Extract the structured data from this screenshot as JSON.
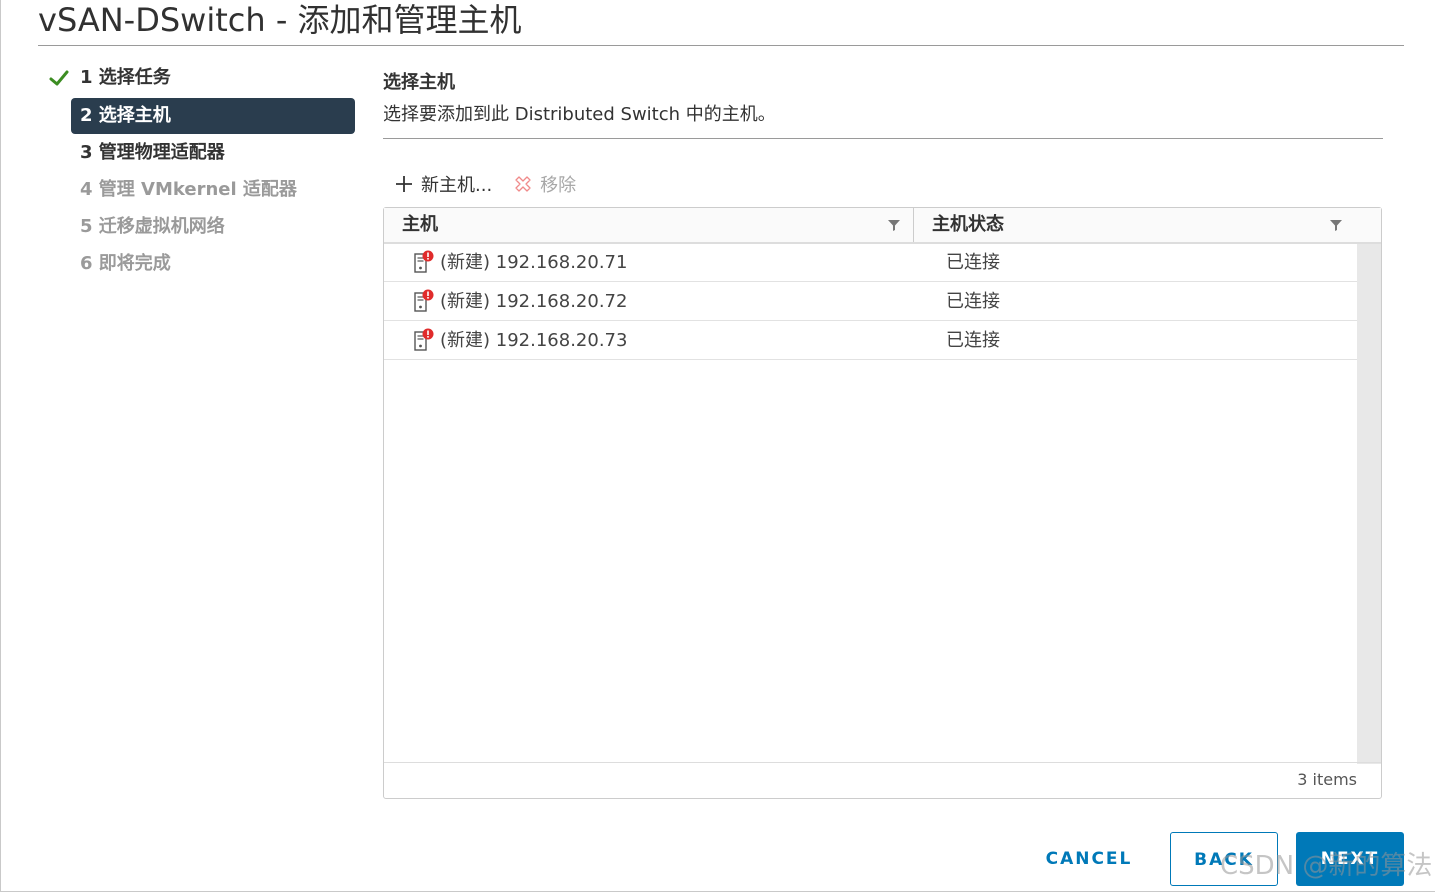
{
  "dialog": {
    "title": "vSAN-DSwitch - 添加和管理主机"
  },
  "steps": [
    {
      "label": "1 选择任务",
      "state": "done"
    },
    {
      "label": "2 选择主机",
      "state": "active"
    },
    {
      "label": "3 管理物理适配器",
      "state": "next"
    },
    {
      "label": "4 管理 VMkernel 适配器",
      "state": "disabled"
    },
    {
      "label": "5 迁移虚拟机网络",
      "state": "disabled"
    },
    {
      "label": "6 即将完成",
      "state": "disabled"
    }
  ],
  "section": {
    "title": "选择主机",
    "description": "选择要添加到此 Distributed Switch 中的主机。"
  },
  "toolbar": {
    "add_label": "新主机...",
    "remove_label": "移除"
  },
  "grid": {
    "columns": [
      "主机",
      "主机状态"
    ],
    "rows": [
      {
        "host": "(新建) 192.168.20.71",
        "status": "已连接"
      },
      {
        "host": "(新建) 192.168.20.72",
        "status": "已连接"
      },
      {
        "host": "(新建) 192.168.20.73",
        "status": "已连接"
      }
    ],
    "count_label": "3 items"
  },
  "buttons": {
    "cancel": "CANCEL",
    "back": "BACK",
    "next": "NEXT"
  },
  "watermark": "CSDN @新的算法",
  "colors": {
    "accent": "#0079b8",
    "active_step_bg": "#2a3d4e",
    "check_green": "#3c8d22",
    "alert_red": "#e02b2b"
  },
  "icons": {
    "step_done": "check-icon",
    "add": "plus-icon",
    "remove": "remove-x-icon",
    "host": "host-alert-icon",
    "filter": "filter-icon"
  }
}
